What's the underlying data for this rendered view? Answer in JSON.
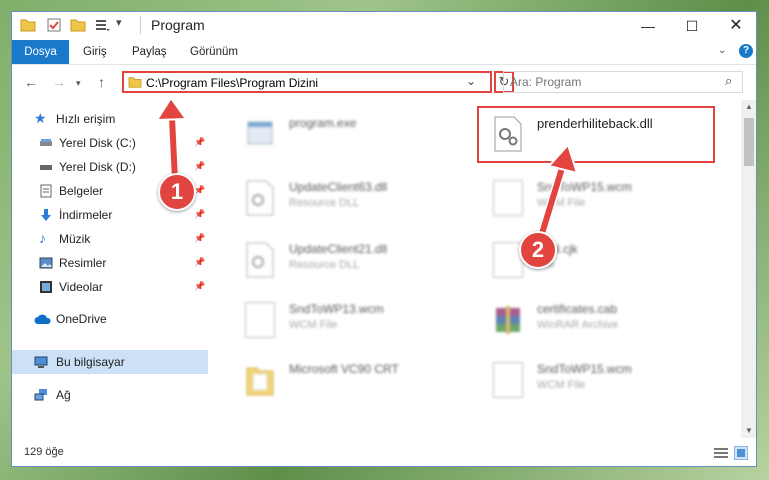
{
  "window": {
    "title": "Program"
  },
  "ribbon": {
    "tabs": [
      "Dosya",
      "Giriş",
      "Paylaş",
      "Görünüm"
    ]
  },
  "address": {
    "path": "C:\\Program Files\\Program Dizini"
  },
  "search": {
    "placeholder": "Ara: Program"
  },
  "sidebar": {
    "items": [
      {
        "label": "Hızlı erişim"
      },
      {
        "label": "Yerel Disk (C:)"
      },
      {
        "label": "Yerel Disk (D:)"
      },
      {
        "label": "Belgeler"
      },
      {
        "label": "İndirmeler"
      },
      {
        "label": "Müzik"
      },
      {
        "label": "Resimler"
      },
      {
        "label": "Videolar"
      },
      {
        "label": "OneDrive"
      },
      {
        "label": "Bu bilgisayar"
      },
      {
        "label": "Ağ"
      }
    ]
  },
  "files": [
    {
      "name": "program.exe",
      "type": ""
    },
    {
      "name": "prenderhiliteback.dll",
      "type": ""
    },
    {
      "name": "UpdateClient63.dll",
      "type": "Resource DLL"
    },
    {
      "name": "SndToWP15.wcm",
      "type": "WCM File"
    },
    {
      "name": "UpdateClient21.dll",
      "type": "Resource DLL"
    },
    {
      "name": "html.cjk",
      "type": "File"
    },
    {
      "name": "SndToWP13.wcm",
      "type": "WCM File"
    },
    {
      "name": "certificates.cab",
      "type": "WinRAR Archive"
    },
    {
      "name": "Microsoft VC90 CRT",
      "type": ""
    },
    {
      "name": "SndToWP15.wcm",
      "type": "WCM File"
    }
  ],
  "status": {
    "count": "129 öğe"
  },
  "annotations": {
    "step1": "1",
    "step2": "2"
  },
  "colors": {
    "accent": "#1979ca",
    "highlight": "#e2443f",
    "selection": "#cce1f5"
  }
}
